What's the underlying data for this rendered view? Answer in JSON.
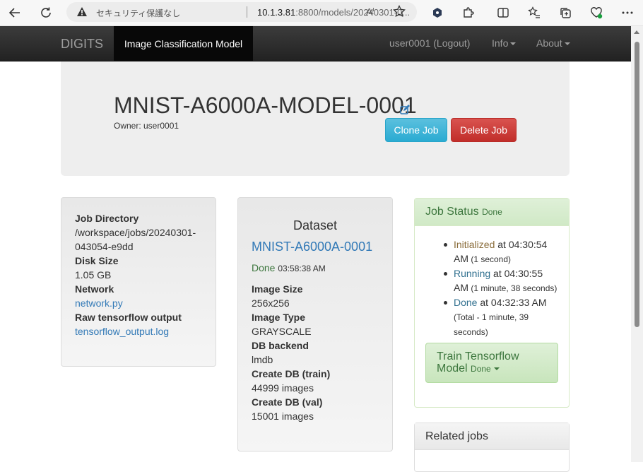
{
  "browser": {
    "insecure_label": "セキュリティ保護なし",
    "url_host": "10.1.3.81",
    "url_rest": ":8800/models/20240301-0..."
  },
  "navbar": {
    "brand": "DIGITS",
    "active": "Image Classification Model",
    "user": "user0001 (Logout)",
    "info": "Info",
    "about": "About"
  },
  "job": {
    "title": "MNIST-A6000A-MODEL-0001",
    "owner": "Owner: user0001",
    "clone_label": "Clone Job",
    "delete_label": "Delete Job"
  },
  "info_panel": {
    "job_dir_label": "Job Directory",
    "job_dir_line1": "/workspace/jobs/20240301-",
    "job_dir_line2": "043054-e9dd",
    "disk_label": "Disk Size",
    "disk_value": "1.05 GB",
    "network_label": "Network",
    "network_link": "network.py",
    "raw_label": "Raw tensorflow output",
    "raw_link": "tensorflow_output.log"
  },
  "dataset_panel": {
    "heading": "Dataset",
    "name": "MNIST-A6000A-0001",
    "status": "Done",
    "status_time": "03:58:38 AM",
    "image_size_label": "Image Size",
    "image_size_value": "256x256",
    "image_type_label": "Image Type",
    "image_type_value": "GRAYSCALE",
    "db_backend_label": "DB backend",
    "db_backend_value": "lmdb",
    "train_label": "Create DB (train)",
    "train_value": "44999 images",
    "val_label": "Create DB (val)",
    "val_value": "15001 images"
  },
  "job_status": {
    "title": "Job Status",
    "state": "Done",
    "items": [
      {
        "state": "Initialized",
        "at": " at 04:30:54",
        "line2": "AM",
        "dur": " (1 second)"
      },
      {
        "state": "Running",
        "at": " at 04:30:55",
        "line2": "AM",
        "dur": " (1 minute, 38 seconds)"
      },
      {
        "state": "Done",
        "at": " at 04:32:33 AM",
        "line2": "(Total - 1 minute, 39",
        "line3": "seconds)"
      }
    ],
    "sub_title_line1": "Train Tensorflow",
    "sub_title_line2": "Model",
    "sub_state": "Done"
  },
  "related": {
    "title": "Related jobs"
  }
}
